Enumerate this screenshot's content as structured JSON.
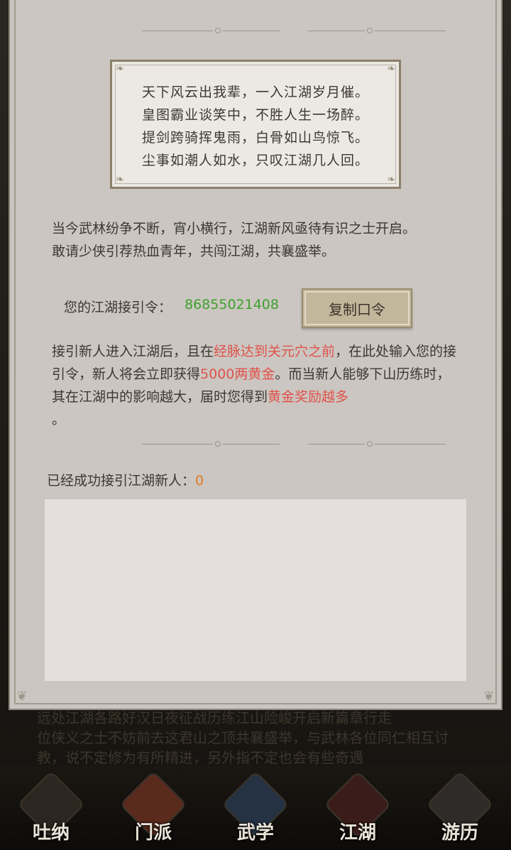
{
  "background": {
    "line1": "远处江湖各路好汉日夜征战历练江山险峻开启新篇章行走",
    "line2": "位侠义之士不妨前去这君山之顶共襄盛举，与武林各位同仁相互讨",
    "line3": "教，说不定修为有所精进，另外指不定也会有些奇遇"
  },
  "nav": [
    {
      "label": "吐纳",
      "icon": "warrior-icon"
    },
    {
      "label": "门派",
      "icon": "banner-icon"
    },
    {
      "label": "武学",
      "icon": "scroll-icon"
    },
    {
      "label": "江湖",
      "icon": "hat-icon"
    },
    {
      "label": "游历",
      "icon": "horse-icon"
    }
  ],
  "poem": [
    "天下风云出我辈，一入江湖岁月催。",
    "皇图霸业谈笑中，不胜人生一场醉。",
    "提剑跨骑挥鬼雨，白骨如山鸟惊飞。",
    "尘事如潮人如水，只叹江湖几人回。"
  ],
  "intro": {
    "line1": "当今武林纷争不断，宵小横行，江湖新风亟待有识之士开启。",
    "line2": "敢请少侠引荐热血青年，共闯江湖，共襄盛举。"
  },
  "invite": {
    "label": "您的江湖接引令：",
    "code": "86855021408",
    "copy_button": "复制口令"
  },
  "rules": {
    "p1": "接引新人进入江湖后，且在",
    "h1": "经脉达到关元穴之前",
    "p2": "，在此处输入您的接引令，新人将会立即获得",
    "h2": "5000两黄金",
    "p3": "。而当新人能够下山历练时，其在江湖中的影响越大，届时您得到",
    "h3": "黄金奖励越多",
    "p4": "。"
  },
  "success": {
    "label": "已经成功接引江湖新人：",
    "count": "0"
  },
  "colors": {
    "code_green": "#3ea12e",
    "highlight_red": "#e0524b",
    "count_orange": "#e07a25"
  }
}
